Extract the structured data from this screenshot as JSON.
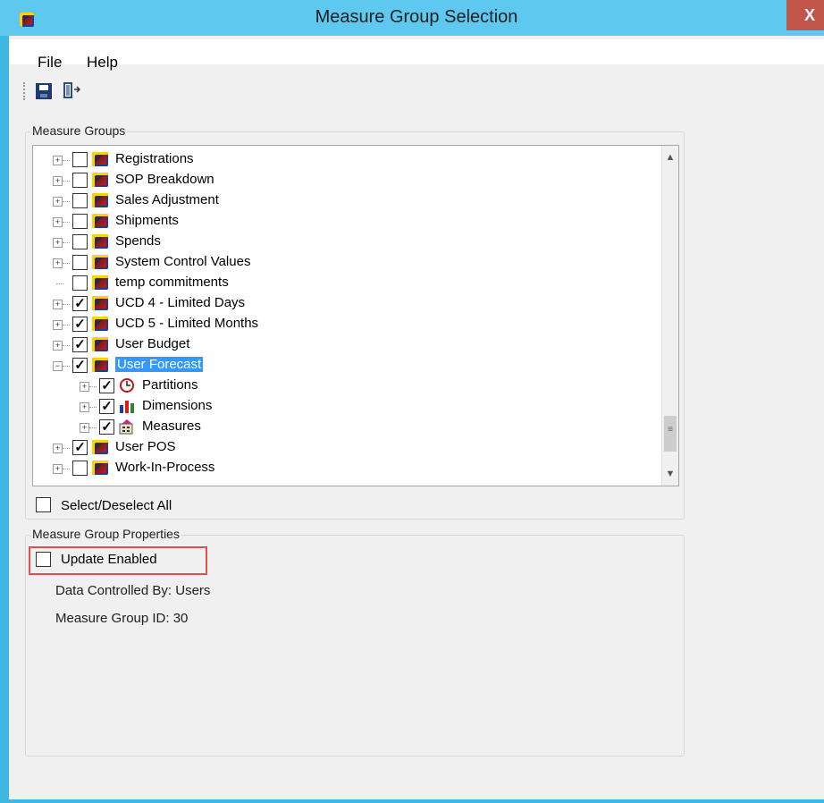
{
  "window": {
    "title": "Measure Group Selection",
    "close_label": "X"
  },
  "menu": {
    "file": "File",
    "help": "Help"
  },
  "groups": {
    "measure_groups_label": "Measure Groups",
    "properties_label": "Measure Group Properties"
  },
  "tree": [
    {
      "label": "Registrations",
      "checked": false,
      "level": 0,
      "expander": "+",
      "icon": "cube-icon"
    },
    {
      "label": "SOP Breakdown",
      "checked": false,
      "level": 0,
      "expander": "+",
      "icon": "cube-icon"
    },
    {
      "label": "Sales Adjustment",
      "checked": false,
      "level": 0,
      "expander": "+",
      "icon": "cube-icon"
    },
    {
      "label": "Shipments",
      "checked": false,
      "level": 0,
      "expander": "+",
      "icon": "cube-icon"
    },
    {
      "label": "Spends",
      "checked": false,
      "level": 0,
      "expander": "+",
      "icon": "cube-icon"
    },
    {
      "label": "System Control Values",
      "checked": false,
      "level": 0,
      "expander": "+",
      "icon": "cube-icon"
    },
    {
      "label": "temp commitments",
      "checked": false,
      "level": 0,
      "expander": "",
      "icon": "cube-icon"
    },
    {
      "label": "UCD 4 - Limited Days",
      "checked": true,
      "level": 0,
      "expander": "+",
      "icon": "cube-icon"
    },
    {
      "label": "UCD 5 -  Limited Months",
      "checked": true,
      "level": 0,
      "expander": "+",
      "icon": "cube-icon"
    },
    {
      "label": "User Budget",
      "checked": true,
      "level": 0,
      "expander": "+",
      "icon": "cube-icon"
    },
    {
      "label": "User Forecast",
      "checked": true,
      "level": 0,
      "expander": "−",
      "icon": "cube-icon",
      "selected": true
    },
    {
      "label": "Partitions",
      "checked": true,
      "level": 1,
      "expander": "+",
      "icon": "clock-icon"
    },
    {
      "label": "Dimensions",
      "checked": true,
      "level": 1,
      "expander": "+",
      "icon": "bar-chart-icon"
    },
    {
      "label": "Measures",
      "checked": true,
      "level": 1,
      "expander": "+",
      "icon": "calculator-icon"
    },
    {
      "label": "User POS",
      "checked": true,
      "level": 0,
      "expander": "+",
      "icon": "cube-icon"
    },
    {
      "label": "Work-In-Process",
      "checked": false,
      "level": 0,
      "expander": "+",
      "icon": "cube-icon"
    }
  ],
  "select_all": {
    "label": "Select/Deselect All",
    "checked": false
  },
  "properties": {
    "update_enabled_label": "Update Enabled",
    "update_enabled_checked": false,
    "data_controlled_by": "Data Controlled By: Users",
    "measure_group_id": "Measure Group ID: 30"
  },
  "colors": {
    "titlebar": "#5fc8ee",
    "selection": "#3399ff",
    "highlight_border": "#e04e4e"
  }
}
